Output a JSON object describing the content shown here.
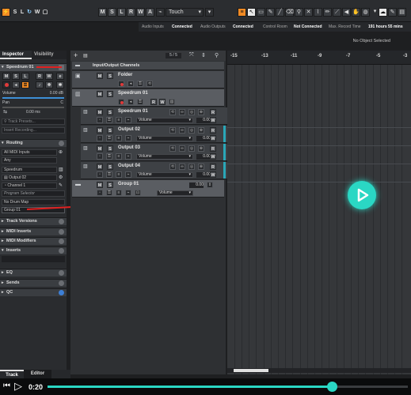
{
  "toolbar": {
    "mode_buttons": [
      "M",
      "S",
      "L",
      "R",
      "W",
      "A"
    ],
    "automation_mode": "Touch",
    "left_buttons": [
      "S",
      "L",
      "R",
      "W",
      "A"
    ]
  },
  "status": {
    "audio_inputs_label": "Audio Inputs",
    "audio_inputs_value": "Connected",
    "audio_outputs_label": "Audio Outputs",
    "audio_outputs_value": "Connected",
    "control_room_label": "Control Room",
    "control_room_value": "Not Connected",
    "max_record_label": "Max. Record Time",
    "max_record_value": "191 hours 55 mins",
    "selection": "No Object Selected"
  },
  "inspector": {
    "tab_inspector": "Inspector",
    "tab_visibility": "Visibility",
    "track_name": "Speedrum 01",
    "volume_label": "Volume",
    "volume_value": "0.00 dB",
    "pan_label": "Pan",
    "pan_value": "C",
    "delay_value": "0.00 ms",
    "track_presets_placeholder": "Track Presets...",
    "insert_recording": "Insert Recording...",
    "routing_label": "Routing",
    "midi_input": "All MIDI Inputs",
    "midi_channel_in": "Any",
    "instrument": "Speedrum",
    "output": "Output 02",
    "channel": "Channel 1",
    "program_selector": "Program Selector",
    "drum_map": "No Drum Map",
    "group": "Group 01",
    "sections": [
      "Track Versions",
      "MIDI Inserts",
      "MIDI Modifiers",
      "Inserts",
      "EQ",
      "Sends",
      "QC"
    ],
    "tab_track": "Track",
    "tab_editor": "Editor"
  },
  "tracklist": {
    "counter": "5 / 5",
    "folder_header": "Input/Output Channels",
    "tracks": [
      {
        "name": "Folder"
      },
      {
        "name": "Speedrum 01"
      },
      {
        "name": "Speedrum 01",
        "param": "Volume",
        "value": "0.00"
      },
      {
        "name": "Output 02",
        "param": "Volume",
        "value": "0.00"
      },
      {
        "name": "Output 03",
        "param": "Volume",
        "value": "0.00"
      },
      {
        "name": "Output 04",
        "param": "Volume",
        "value": "0.00"
      },
      {
        "name": "Group 01",
        "param": "Volume",
        "value": "0.00"
      }
    ]
  },
  "ruler": {
    "ticks": [
      "-15",
      "-13",
      "-11",
      "-9",
      "-7",
      "-5",
      "-3"
    ]
  },
  "video": {
    "time": "0:20",
    "progress": 0.79
  },
  "colors": {
    "accent_orange": "#f08a24",
    "play_teal": "#2ad7c4",
    "record_red": "#e03a3a",
    "annotation_red": "#e02020"
  }
}
